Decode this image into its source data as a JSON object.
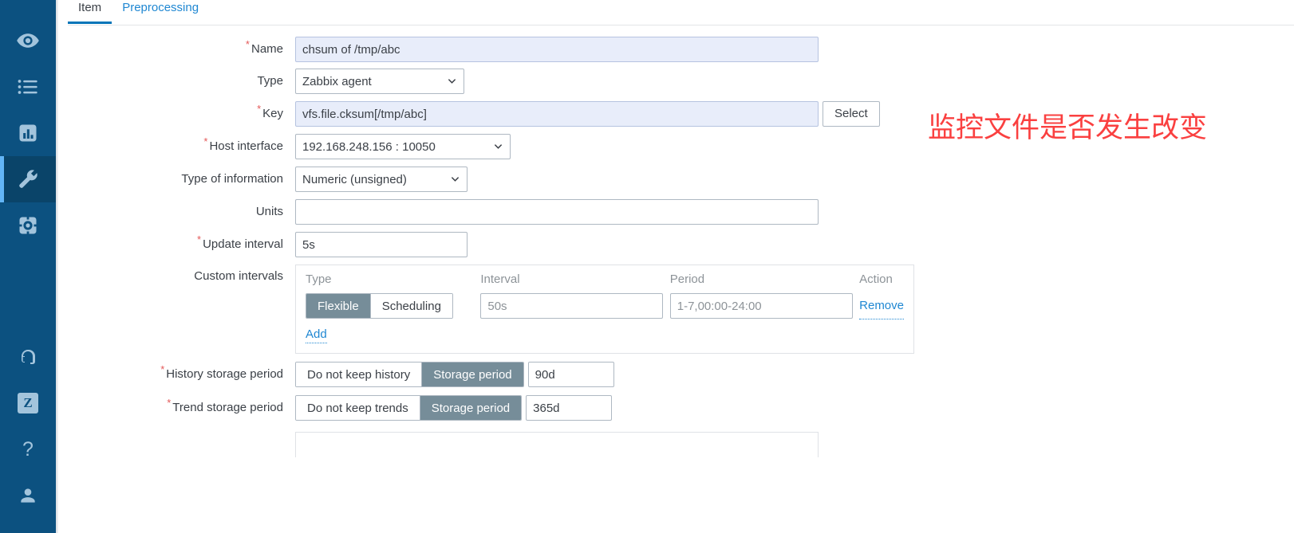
{
  "sidebar": {
    "top_items": [
      {
        "name": "monitoring",
        "icon": "eye-icon",
        "active": false
      },
      {
        "name": "inventory",
        "icon": "list-icon",
        "active": false
      },
      {
        "name": "reports",
        "icon": "bar-chart-icon",
        "active": false
      },
      {
        "name": "configuration",
        "icon": "wrench-icon",
        "active": true
      },
      {
        "name": "administration",
        "icon": "gear-icon",
        "active": false
      }
    ],
    "bottom_items": [
      {
        "name": "support",
        "icon": "headset-icon"
      },
      {
        "name": "zabbix-integrations",
        "icon": "z-badge-icon",
        "glyph": "Z"
      },
      {
        "name": "help",
        "icon": "question-mark-icon",
        "glyph": "?"
      },
      {
        "name": "user-settings",
        "icon": "person-icon"
      }
    ],
    "colors": {
      "bg": "#0c5180",
      "active_bg": "#0a4469",
      "active_bar": "#63b5f6",
      "icon": "#a3c4dc"
    }
  },
  "tabs": [
    {
      "label": "Item",
      "active": true
    },
    {
      "label": "Preprocessing",
      "active": false
    }
  ],
  "form": {
    "name": {
      "label": "Name",
      "required": true,
      "value": "chsum of /tmp/abc",
      "placeholder": ""
    },
    "type": {
      "label": "Type",
      "required": false,
      "value": "Zabbix agent"
    },
    "key": {
      "label": "Key",
      "required": true,
      "value": "vfs.file.cksum[/tmp/abc]",
      "placeholder": "",
      "select_button": "Select"
    },
    "host_interface": {
      "label": "Host interface",
      "required": true,
      "value": "192.168.248.156 : 10050"
    },
    "type_of_information": {
      "label": "Type of information",
      "required": false,
      "value": "Numeric (unsigned)"
    },
    "units": {
      "label": "Units",
      "required": false,
      "value": "",
      "placeholder": ""
    },
    "update_interval": {
      "label": "Update interval",
      "required": true,
      "value": "5s",
      "placeholder": ""
    },
    "custom_intervals": {
      "label": "Custom intervals",
      "headers": [
        "Type",
        "Interval",
        "Period",
        "Action"
      ],
      "rows": [
        {
          "type_options": [
            "Flexible",
            "Scheduling"
          ],
          "type_selected": "Flexible",
          "interval_value": "",
          "interval_placeholder": "50s",
          "period_value": "",
          "period_placeholder": "1-7,00:00-24:00",
          "action_label": "Remove"
        }
      ],
      "add_label": "Add"
    },
    "history_storage_period": {
      "label": "History storage period",
      "required": true,
      "options": [
        "Do not keep history",
        "Storage period"
      ],
      "selected": "Storage period",
      "value": "90d"
    },
    "trend_storage_period": {
      "label": "Trend storage period",
      "required": true,
      "options": [
        "Do not keep trends",
        "Storage period"
      ],
      "selected": "Storage period",
      "value": "365d"
    }
  },
  "annotation": {
    "text": "监控文件是否发生改变",
    "color": "#fa4040"
  }
}
